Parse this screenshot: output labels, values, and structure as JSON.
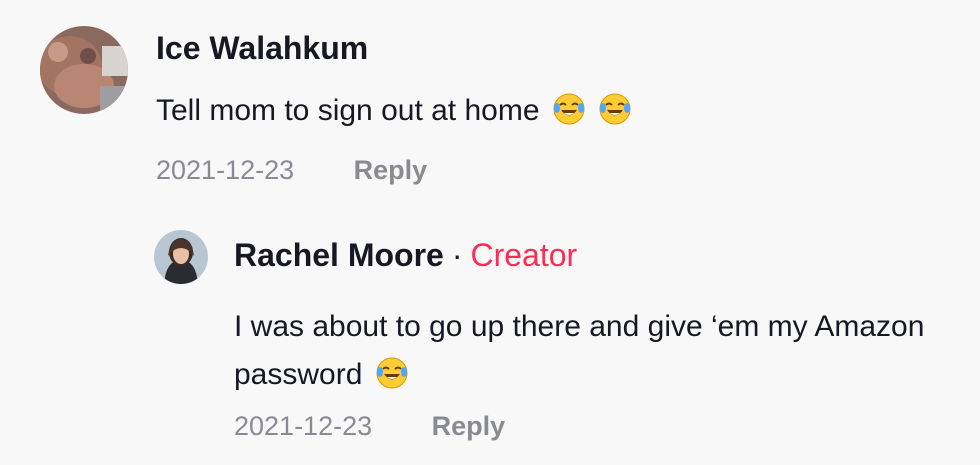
{
  "comments": [
    {
      "author": "Ice Walahkum",
      "text": "Tell mom to sign out at home",
      "emojis": [
        "face-with-tears-of-joy",
        "face-with-tears-of-joy"
      ],
      "date": "2021-12-23",
      "reply_label": "Reply"
    }
  ],
  "reply": {
    "author": "Rachel Moore",
    "separator": "·",
    "badge": "Creator",
    "text": "I was about to go up there and give ‘em my Amazon password",
    "emojis": [
      "face-with-tears-of-joy"
    ],
    "date": "2021-12-23",
    "reply_label": "Reply"
  },
  "colors": {
    "creator_badge": "#fe2c55",
    "meta_text": "#8a8b91",
    "primary_text": "#161823",
    "background": "#f8f8f8"
  }
}
